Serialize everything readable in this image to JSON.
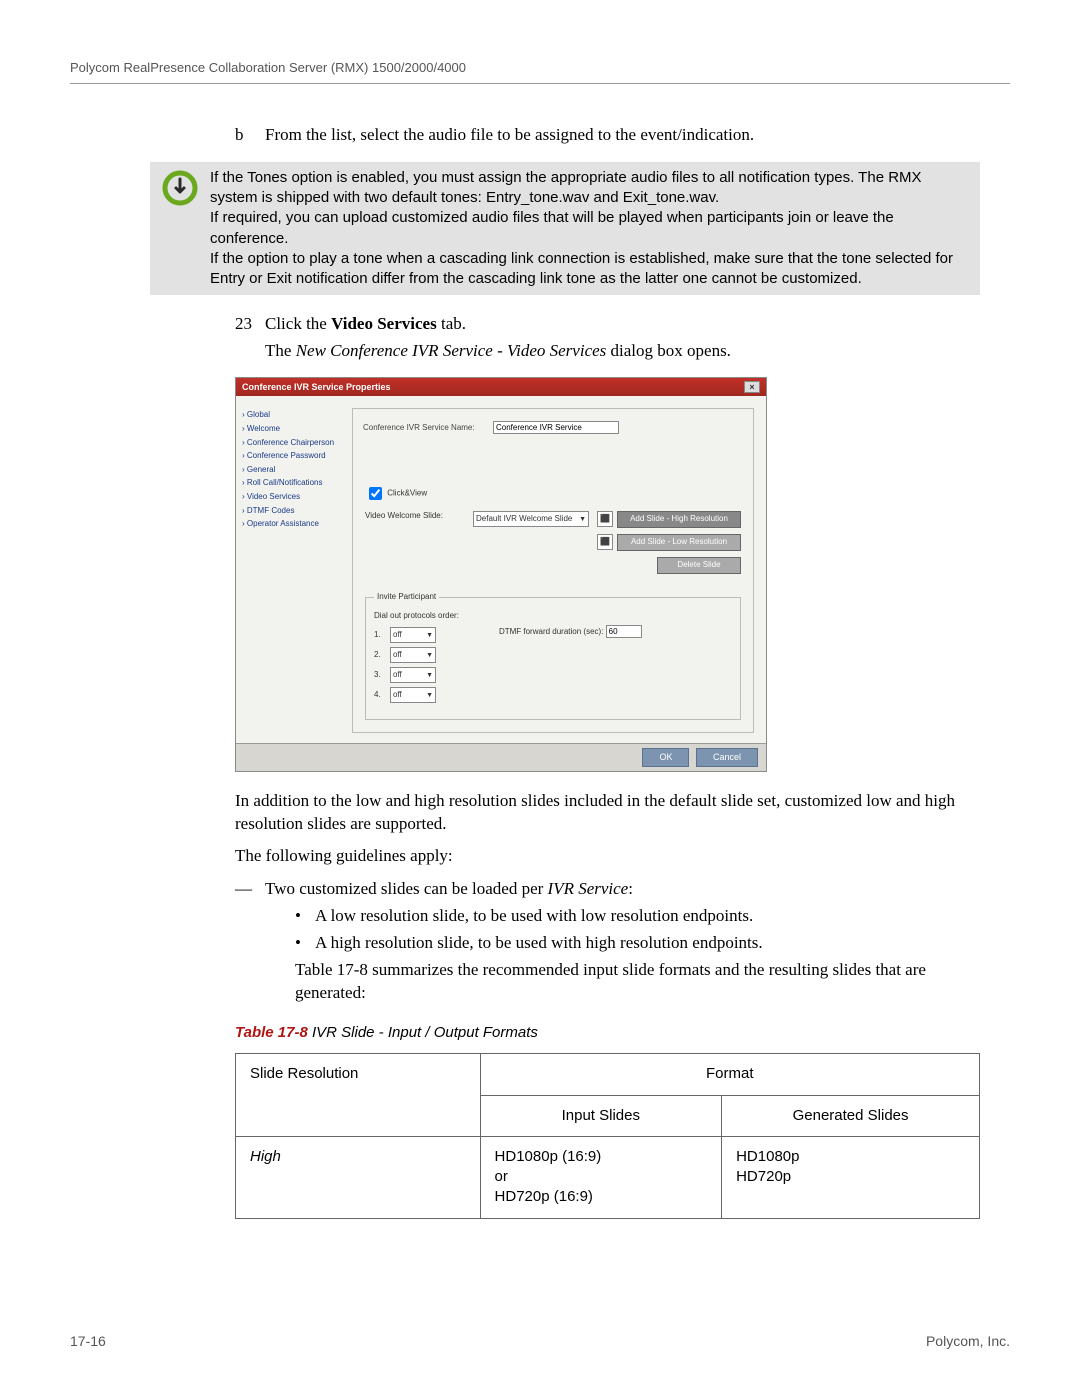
{
  "header": "Polycom RealPresence Collaboration Server (RMX) 1500/2000/4000",
  "step_b": {
    "label": "b",
    "text": "From the list, select the audio file to be assigned to the event/indication."
  },
  "note": {
    "p1": "If the Tones option is enabled, you must assign the appropriate audio files to all notification types. The RMX system is shipped with two default tones: Entry_tone.wav and Exit_tone.wav.",
    "p2": "If required, you can upload customized audio files that will be played when participants join or leave the conference.",
    "p3": "If the option to play a tone when a cascading link connection is established, make sure that the tone selected for Entry or Exit notification differ from the cascading link tone as the latter one cannot be customized."
  },
  "step23": {
    "num": "23",
    "text_pre": "Click the ",
    "text_bold": "Video Services",
    "text_post": " tab.",
    "sub_pre": "The ",
    "sub_ital": "New Conference IVR Service - Video Services",
    "sub_post": " dialog box opens."
  },
  "dialog": {
    "title": "Conference IVR Service Properties",
    "sidebar": [
      "Global",
      "Welcome",
      "Conference Chairperson",
      "Conference Password",
      "General",
      "Roll Call/Notifications",
      "Video Services",
      "DTMF Codes",
      "Operator Assistance"
    ],
    "service_name_label": "Conference IVR Service Name:",
    "service_name_value": "Conference IVR Service",
    "clickview_legend": "Click&View",
    "checkbox_label": "Click&View",
    "welcome_slide_label": "Video Welcome Slide:",
    "welcome_slide_value": "Default IVR Welcome Slide",
    "btn_add_high": "Add Slide - High Resolution",
    "btn_add_low": "Add Slide - Low Resolution",
    "btn_delete": "Delete Slide",
    "invite_legend": "Invite Participant",
    "dialout_label": "Dial out protocols order:",
    "dtmf_label": "DTMF forward duration (sec):",
    "dtmf_value": "60",
    "proto": [
      {
        "n": "1.",
        "v": "off"
      },
      {
        "n": "2.",
        "v": "off"
      },
      {
        "n": "3.",
        "v": "off"
      },
      {
        "n": "4.",
        "v": "off"
      }
    ],
    "ok": "OK",
    "cancel": "Cancel"
  },
  "after": {
    "p1": "In addition to the low and high resolution slides included in the default slide set, customized low and high resolution slides are supported.",
    "p2": "The following guidelines apply:",
    "dash1_pre": "Two customized slides can be loaded per ",
    "dash1_ital": "IVR Service",
    "dash1_post": ":",
    "b1": "A low resolution slide, to be used with low resolution endpoints.",
    "b2": "A high resolution slide, to be used with high resolution endpoints.",
    "p3": "Table 17-8 summarizes the recommended input slide formats and the resulting slides that are generated:"
  },
  "table": {
    "caption_num": "Table 17-8",
    "caption_rest": "  IVR Slide - Input / Output Formats",
    "h_slide": "Slide Resolution",
    "h_format": "Format",
    "h_input": "Input Slides",
    "h_output": "Generated Slides",
    "row_high_label": "High",
    "row_high_input": "HD1080p (16:9)\nor\nHD720p (16:9)",
    "row_high_output": "HD1080p\nHD720p"
  },
  "footer": {
    "left": "17-16",
    "right": "Polycom, Inc."
  }
}
